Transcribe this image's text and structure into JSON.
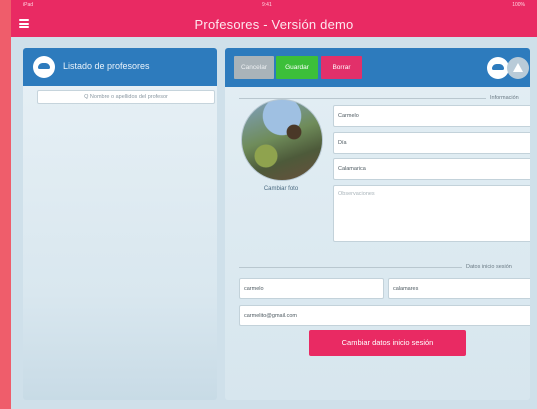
{
  "status_bar": {
    "carrier": "iPad",
    "time": "9:41",
    "battery": "100%"
  },
  "app": {
    "title": "Profesores - Versión demo"
  },
  "left_panel": {
    "header_label": "Listado de profesores",
    "search_placeholder": "Q  Nombre o apellidos del profesor"
  },
  "toolbar": {
    "cancel_label": "Cancelar",
    "save_label": "Guardar",
    "delete_label": "Borrar"
  },
  "info_section": {
    "label": "Información",
    "change_photo_label": "Cambiar foto",
    "name_value": "Carmelo",
    "day_value": "Día",
    "surname_value": "Calamarica",
    "notes_placeholder": "Observaciones"
  },
  "login_section": {
    "label": "Datos inicio sesión",
    "username_value": "carmelo",
    "password_value": "calamares",
    "email_value": "carmelito@gmail.com",
    "change_button_label": "Cambiar datos inicio sesión"
  },
  "colors": {
    "brand_pink": "#e92a63",
    "header_blue": "#2d7bbd",
    "save_green": "#3cbf3a",
    "cancel_grey": "#a9b3b9"
  }
}
